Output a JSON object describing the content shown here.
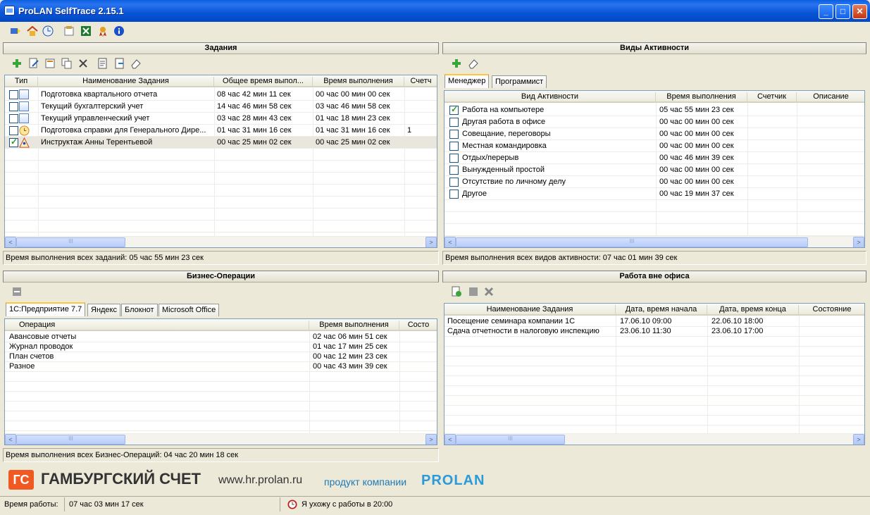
{
  "window": {
    "title": "ProLAN SelfTrace 2.15.1",
    "min": "_",
    "max": "□",
    "close": "✕"
  },
  "tasks": {
    "title": "Задания",
    "columns": [
      "Тип",
      "Наименование Задания",
      "Общее время выпол...",
      "Время выполнения",
      "Счетч"
    ],
    "rows": [
      {
        "checked": false,
        "name": "Подготовка квартального отчета",
        "total": "08 час 42 мин 11 сек",
        "time": "00 час 00 мин 00 сек",
        "count": ""
      },
      {
        "checked": false,
        "name": "Текущий бухгалтерский учет",
        "total": "14 час 46 мин 58 сек",
        "time": "03 час 46 мин 58 сек",
        "count": ""
      },
      {
        "checked": false,
        "name": "Текущий управленческий учет",
        "total": "03 час 28 мин 43 сек",
        "time": "01 час 18 мин 23 сек",
        "count": ""
      },
      {
        "checked": false,
        "name": "Подготовка справки для Генерального Дире...",
        "total": "01 час 31 мин 16 сек",
        "time": "01 час 31 мин 16 сек",
        "count": "1"
      },
      {
        "checked": true,
        "name": "Инструктаж Анны Терентьевой",
        "total": "00 час 25 мин 02 сек",
        "time": "00 час 25 мин 02 сек",
        "count": ""
      }
    ],
    "status": "Время выполнения всех заданий: 05 час 55 мин 23 сек"
  },
  "activity": {
    "title": "Виды Активности",
    "tabs": [
      "Менеджер",
      "Программист"
    ],
    "columns": [
      "Вид Активности",
      "Время выполнения",
      "Счетчик",
      "Описание"
    ],
    "rows": [
      {
        "checked": true,
        "name": "Работа на компьютере",
        "time": "05 час 55 мин 23 сек"
      },
      {
        "checked": false,
        "name": "Другая работа в офисе",
        "time": "00 час 00 мин 00 сек"
      },
      {
        "checked": false,
        "name": "Совещание, переговоры",
        "time": "00 час 00 мин 00 сек"
      },
      {
        "checked": false,
        "name": "Местная командировка",
        "time": "00 час 00 мин 00 сек"
      },
      {
        "checked": false,
        "name": "Отдых/перерыв",
        "time": "00 час 46 мин 39 сек"
      },
      {
        "checked": false,
        "name": "Вынужденный простой",
        "time": "00 час 00 мин 00 сек"
      },
      {
        "checked": false,
        "name": "Отсутствие по личному делу",
        "time": "00 час 00 мин 00 сек"
      },
      {
        "checked": false,
        "name": "Другое",
        "time": "00 час 19 мин 37 сек"
      }
    ],
    "status": "Время выполнения всех видов активности: 07 час 01 мин 39 сек"
  },
  "business": {
    "title": "Бизнес-Операции",
    "tabs": [
      "1С:Предприятие 7.7",
      "Яндекс",
      "Блокнот",
      "Microsoft Office"
    ],
    "columns": [
      "Операция",
      "Время выполнения",
      "Состо"
    ],
    "rows": [
      {
        "name": "Авансовые отчеты",
        "time": "02 час 06 мин 51 сек"
      },
      {
        "name": "Журнал проводок",
        "time": "01 час 17 мин 25 сек"
      },
      {
        "name": "План счетов",
        "time": "00 час 12 мин 23 сек"
      },
      {
        "name": "Разное",
        "time": "00 час 43 мин 39 сек"
      }
    ],
    "status": "Время выполнения всех Бизнес-Операций: 04 час 20 мин 18 сек"
  },
  "outside": {
    "title": "Работа вне офиса",
    "columns": [
      "Наименование Задания",
      "Дата, время начала",
      "Дата, время конца",
      "Состояние"
    ],
    "rows": [
      {
        "name": "Посещение семинара компании 1С",
        "start": "17.06.10  09:00",
        "end": "22.06.10  18:00"
      },
      {
        "name": "Сдача отчетности в налоговую инспекцию",
        "start": "23.06.10  11:30",
        "end": "23.06.10  17:00"
      }
    ]
  },
  "banner": {
    "logo": "ГС",
    "name": "ГАМБУРГСКИЙ СЧЕТ",
    "url": "www.hr.prolan.ru",
    "product": "продукт компании",
    "brand": "PROLAN"
  },
  "statusbar": {
    "label": "Время работы:",
    "worktime": "07 час 03 мин 17 сек",
    "leave": "Я ухожу с работы в 20:00"
  },
  "scroll": {
    "grip": "III",
    "left": "<",
    "right": ">"
  }
}
